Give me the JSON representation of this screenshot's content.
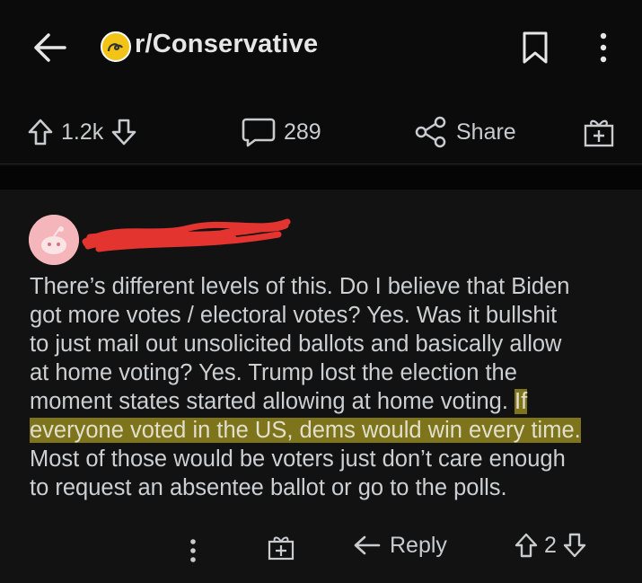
{
  "header": {
    "subreddit": "r/Conservative",
    "back_icon": "arrow-left-icon",
    "save_icon": "bookmark-icon",
    "more_icon": "more-vertical-icon"
  },
  "post_actions": {
    "upvotes": "1.2k",
    "comments": "289",
    "share_label": "Share"
  },
  "comment": {
    "username_redacted": true,
    "line1": "There’s different levels of this.  Do I believe that Biden",
    "line2": "got more votes / electoral votes? Yes.  Was it bullshit",
    "line3": "to just mail out unsolicited ballots and basically allow",
    "line4": "at home voting? Yes.  Trump lost the election the",
    "line5a": "moment states started allowing at home voting.",
    "line5b": "If",
    "line6": "everyone voted in the US, dems would win every time.",
    "line7": "Most of those would be voters just don’t care enough",
    "line8": "to request an absentee ballot or go to the polls.",
    "highlight_color": "#d6c423"
  },
  "comment_actions": {
    "reply_label": "Reply",
    "score": "2"
  }
}
